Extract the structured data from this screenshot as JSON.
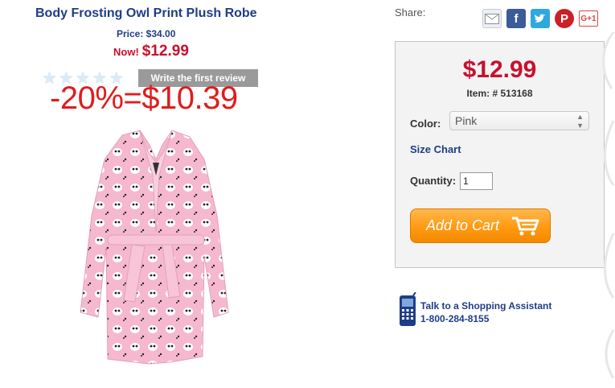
{
  "product": {
    "title": "Body Frosting Owl Print Plush Robe",
    "price_label": "Price: $34.00",
    "now_label": "Now!",
    "now_price": "$12.99",
    "rating_stars": 0,
    "review_button": "Write the first review",
    "discount_overlay": "-20%=$10.39"
  },
  "share": {
    "label": "Share:",
    "icons": [
      "email-icon",
      "facebook-icon",
      "twitter-icon",
      "pinterest-icon",
      "google-plus-icon"
    ],
    "gplus_text": "G+1"
  },
  "buybox": {
    "price": "$12.99",
    "item": "Item: # 513168",
    "color_label": "Color:",
    "color_value": "Pink",
    "size_chart": "Size Chart",
    "quantity_label": "Quantity:",
    "quantity_value": "1",
    "add_to_cart": "Add to Cart"
  },
  "assistant": {
    "line1": "Talk to a Shopping Assistant",
    "line2": "1-800-284-8155"
  },
  "colors": {
    "brand_blue": "#1f3d87",
    "price_red": "#c8102e",
    "cart_orange": "#ff9a12",
    "robe_pink": "#f5b8cf"
  }
}
